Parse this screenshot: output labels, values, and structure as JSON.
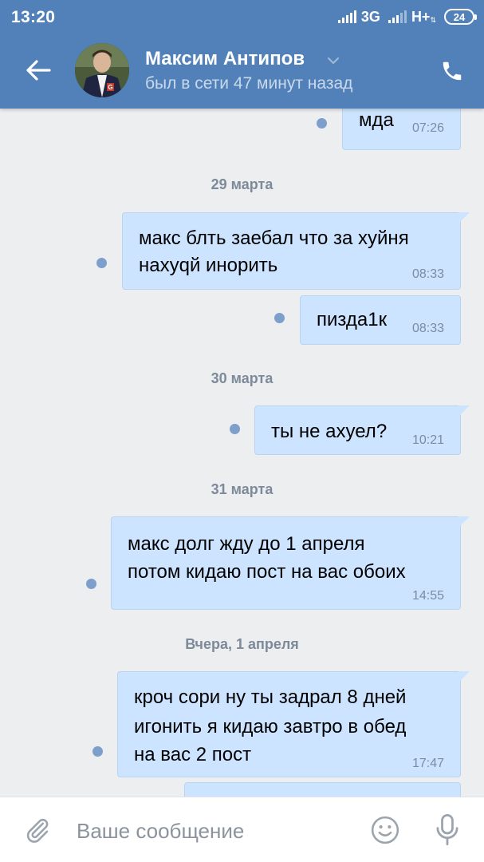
{
  "status_bar": {
    "time": "13:20",
    "network_1": "3G",
    "network_2": "H+",
    "battery": "24"
  },
  "header": {
    "contact_name": "Максим Антипов",
    "contact_status": "был в сети 47 минут назад"
  },
  "messages": [
    {
      "kind": "message",
      "text": "мда",
      "time": "07:26",
      "read": false
    },
    {
      "kind": "date",
      "text": "29 марта"
    },
    {
      "kind": "message",
      "text": "макс блть заебал что за хуйня\nнахуqй инорить",
      "time": "08:33",
      "read": false
    },
    {
      "kind": "message",
      "text": "пизда1к",
      "time": "08:33",
      "read": false
    },
    {
      "kind": "date",
      "text": "30 марта"
    },
    {
      "kind": "message",
      "text": "ты не ахуел?",
      "time": "10:21",
      "read": false
    },
    {
      "kind": "date",
      "text": "31 марта"
    },
    {
      "kind": "message",
      "text": "макс долг жду до 1 апреля\nпотом кидаю пост на вас обоих",
      "time": "14:55",
      "read": false
    },
    {
      "kind": "date",
      "text": "Вчера, 1 апреля"
    },
    {
      "kind": "message",
      "text": "кроч сори ну ты задрал 8 дней\nигонить я кидаю завтро в обед\nна вас 2 пост",
      "time": "17:47",
      "read": false
    }
  ],
  "composer": {
    "placeholder": "Ваше сообщение"
  },
  "colors": {
    "header": "#5181b8",
    "bubble_outgoing": "#cce4ff",
    "unread_dot": "#7e9fcb",
    "background": "#edeef0"
  },
  "icons": [
    "back-arrow-icon",
    "chevron-down-icon",
    "phone-icon",
    "paperclip-icon",
    "emoji-icon",
    "microphone-icon"
  ]
}
